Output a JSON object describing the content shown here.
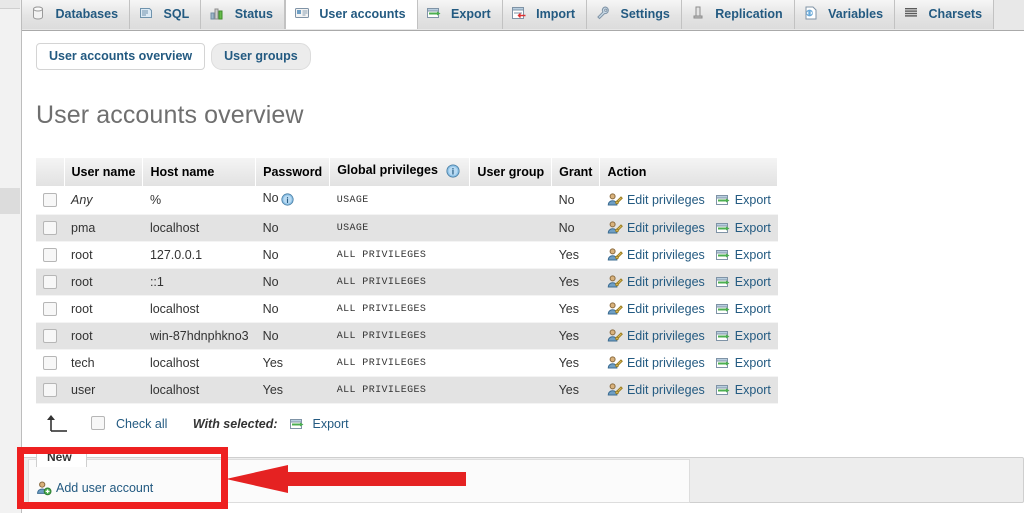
{
  "topnav": {
    "tabs": [
      {
        "label": "Databases",
        "icon": "database-icon",
        "active": false
      },
      {
        "label": "SQL",
        "icon": "sql-icon",
        "active": false
      },
      {
        "label": "Status",
        "icon": "status-icon",
        "active": false
      },
      {
        "label": "User accounts",
        "icon": "user-accounts-icon",
        "active": true
      },
      {
        "label": "Export",
        "icon": "export-icon",
        "active": false
      },
      {
        "label": "Import",
        "icon": "import-icon",
        "active": false
      },
      {
        "label": "Settings",
        "icon": "settings-icon",
        "active": false
      },
      {
        "label": "Replication",
        "icon": "replication-icon",
        "active": false
      },
      {
        "label": "Variables",
        "icon": "variables-icon",
        "active": false
      },
      {
        "label": "Charsets",
        "icon": "charsets-icon",
        "active": false
      }
    ]
  },
  "subtabs": [
    {
      "label": "User accounts overview",
      "active": true
    },
    {
      "label": "User groups",
      "active": false
    }
  ],
  "page": {
    "title": "User accounts overview"
  },
  "table": {
    "headers": [
      "",
      "User name",
      "Host name",
      "Password",
      "Global privileges",
      "User group",
      "Grant",
      "Action"
    ],
    "info_icon": "info-icon",
    "rows": [
      {
        "user": "Any",
        "host": "%",
        "password": "No",
        "password_icon": "info-icon",
        "privileges": "USAGE",
        "group": "",
        "grant": "No",
        "edit": "Edit privileges",
        "export": "Export"
      },
      {
        "user": "pma",
        "host": "localhost",
        "password": "No",
        "password_icon": "",
        "privileges": "USAGE",
        "group": "",
        "grant": "No",
        "edit": "Edit privileges",
        "export": "Export"
      },
      {
        "user": "root",
        "host": "127.0.0.1",
        "password": "No",
        "password_icon": "",
        "privileges": "ALL PRIVILEGES",
        "group": "",
        "grant": "Yes",
        "edit": "Edit privileges",
        "export": "Export"
      },
      {
        "user": "root",
        "host": "::1",
        "password": "No",
        "password_icon": "",
        "privileges": "ALL PRIVILEGES",
        "group": "",
        "grant": "Yes",
        "edit": "Edit privileges",
        "export": "Export"
      },
      {
        "user": "root",
        "host": "localhost",
        "password": "No",
        "password_icon": "",
        "privileges": "ALL PRIVILEGES",
        "group": "",
        "grant": "Yes",
        "edit": "Edit privileges",
        "export": "Export"
      },
      {
        "user": "root",
        "host": "win-87hdnphkno3",
        "password": "No",
        "password_icon": "",
        "privileges": "ALL PRIVILEGES",
        "group": "",
        "grant": "Yes",
        "edit": "Edit privileges",
        "export": "Export"
      },
      {
        "user": "tech",
        "host": "localhost",
        "password": "Yes",
        "password_icon": "",
        "privileges": "ALL PRIVILEGES",
        "group": "",
        "grant": "Yes",
        "edit": "Edit privileges",
        "export": "Export"
      },
      {
        "user": "user",
        "host": "localhost",
        "password": "Yes",
        "password_icon": "",
        "privileges": "ALL PRIVILEGES",
        "group": "",
        "grant": "Yes",
        "edit": "Edit privileges",
        "export": "Export"
      }
    ]
  },
  "with_selected": {
    "check_all": "Check all",
    "label": "With selected:",
    "export": "Export",
    "arrow_icon": "arrow-up-left-icon"
  },
  "new_panel": {
    "legend": "New",
    "add_user": "Add user account",
    "add_user_icon": "add-user-icon"
  },
  "annotation": {
    "rect_color": "#ee2020",
    "arrow_color": "#e52222",
    "arrow_icon": "left-arrow-annotation"
  }
}
